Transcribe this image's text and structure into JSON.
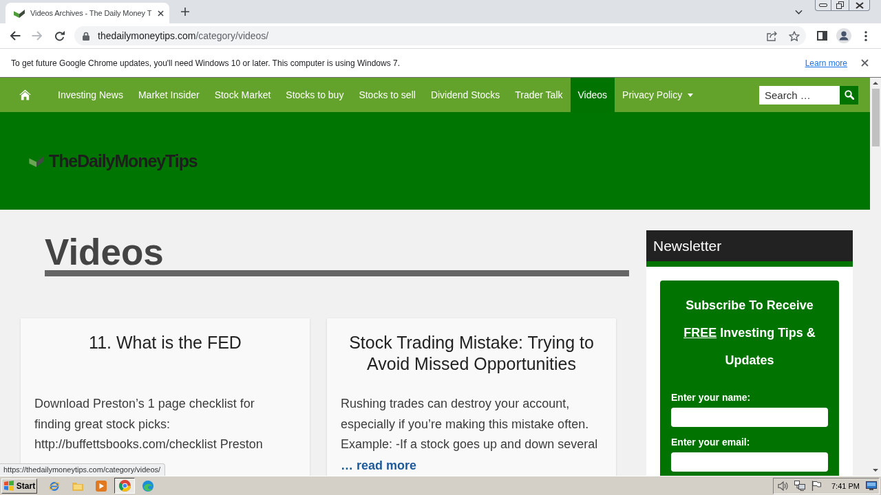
{
  "browser": {
    "tabs": [
      {
        "title": "Videos Archives - The Daily Money T",
        "selected": true
      }
    ],
    "back_disabled": false,
    "forward_disabled": true,
    "address": {
      "host": "thedailymoneytips.com",
      "path": "/category/videos/"
    }
  },
  "infobar": {
    "message": "To get future Google Chrome updates, you'll need Windows 10 or later. This computer is using Windows 7.",
    "link": "Learn more"
  },
  "site_nav": {
    "items": [
      {
        "label": "Investing News",
        "selected": false,
        "dropdown": false
      },
      {
        "label": "Market Insider",
        "selected": false,
        "dropdown": false
      },
      {
        "label": "Stock Market",
        "selected": false,
        "dropdown": false
      },
      {
        "label": "Stocks to buy",
        "selected": false,
        "dropdown": false
      },
      {
        "label": "Stocks to sell",
        "selected": false,
        "dropdown": false
      },
      {
        "label": "Dividend Stocks",
        "selected": false,
        "dropdown": false
      },
      {
        "label": "Trader Talk",
        "selected": false,
        "dropdown": false
      },
      {
        "label": "Videos",
        "selected": true,
        "dropdown": false
      },
      {
        "label": "Privacy Policy",
        "selected": false,
        "dropdown": true
      }
    ],
    "search": {
      "placeholder": "Search …"
    }
  },
  "header": {
    "logo": "TheDailyMoneyTips"
  },
  "archive": {
    "title": "Videos",
    "posts": [
      {
        "title": "11. What is the FED",
        "excerpt": "Download Preston’s 1 page checklist for finding great stock picks: http://buffettsbooks.com/checklist Preston"
      },
      {
        "title": "Stock Trading Mistake: Trying to Avoid Missed Opportunities",
        "excerpt": "Rushing trades can destroy your account, especially if you’re making this mistake often. Example: -If a stock goes up and down several",
        "read_more": "… read more"
      }
    ]
  },
  "sidebar": {
    "widget_title": "Newsletter",
    "heading_start": "Subscribe To Receive",
    "heading_underlined": "FREE",
    "heading_end": "Investing Tips & Updates",
    "fields": [
      {
        "label": "Enter your name:"
      },
      {
        "label": "Enter your email:"
      }
    ]
  },
  "status_url": "https://thedailymoneytips.com/category/videos/",
  "taskbar": {
    "start": "Start",
    "apps": [
      {
        "kind": "ie",
        "selected": false
      },
      {
        "kind": "explorer",
        "selected": false
      },
      {
        "kind": "media",
        "selected": false
      },
      {
        "kind": "chrome",
        "selected": true
      },
      {
        "kind": "edge",
        "selected": false
      }
    ],
    "tray": [
      {
        "kind": "volume"
      },
      {
        "kind": "network"
      },
      {
        "kind": "flag"
      }
    ],
    "clock": "7:41 PM"
  }
}
